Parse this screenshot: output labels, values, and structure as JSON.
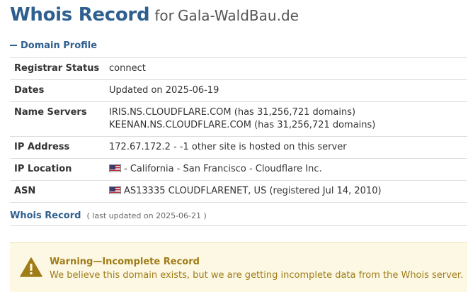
{
  "header": {
    "title": "Whois Record",
    "for_text": "for",
    "domain": "Gala-WaldBau.de"
  },
  "domain_profile": {
    "heading": "Domain Profile",
    "rows": {
      "registrar_status": {
        "label": "Registrar Status",
        "value": "connect"
      },
      "dates": {
        "label": "Dates",
        "value": "Updated on 2025-06-19"
      },
      "name_servers": {
        "label": "Name Servers",
        "line1": "IRIS.NS.CLOUDFLARE.COM (has 31,256,721 domains)",
        "line2": "KEENAN.NS.CLOUDFLARE.COM (has 31,256,721 domains)"
      },
      "ip_address": {
        "label": "IP Address",
        "value": "172.67.172.2 - -1 other site is hosted on this server"
      },
      "ip_location": {
        "label": "IP Location",
        "flag": "us-flag-icon",
        "value": "- California - San Francisco - Cloudflare Inc."
      },
      "asn": {
        "label": "ASN",
        "flag": "us-flag-icon",
        "value": "AS13335 CLOUDFLARENET, US (registered Jul 14, 2010)"
      }
    }
  },
  "whois_record": {
    "link": "Whois Record",
    "updated": "( last updated on 2025-06-21 )"
  },
  "warning": {
    "icon": "warning-triangle-icon",
    "title": "Warning—Incomplete Record",
    "text": "We believe this domain exists, but we are getting incomplete data from the Whois server."
  },
  "colors": {
    "accent": "#2e5f8f",
    "warning_bg": "#fcf8e3",
    "warning_text": "#a07c18"
  }
}
